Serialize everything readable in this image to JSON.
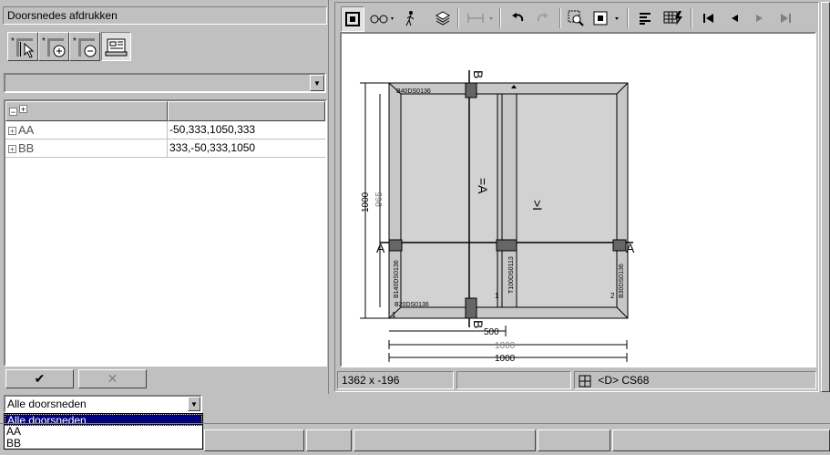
{
  "panel": {
    "title": "Doorsnedes afdrukken",
    "tools": [
      "select-section-tool",
      "add-section-tool",
      "remove-section-tool",
      "print-preview-tool"
    ]
  },
  "table": {
    "header_col2": "",
    "rows": [
      {
        "name": "AA",
        "value": "-50,333,1050,333"
      },
      {
        "name": "BB",
        "value": "333,-50,333,1050"
      }
    ]
  },
  "buttons": {
    "ok": "✔",
    "cancel": "✕"
  },
  "filter": {
    "selected": "Alle doorsneden",
    "options": [
      "Alle doorsneden",
      "AA",
      "BB"
    ]
  },
  "toolbar": {
    "icons": [
      "view-frame-icon",
      "glasses-icon",
      "walk-icon",
      "layers-icon",
      "dimension-icon",
      "undo-icon",
      "redo-icon",
      "zoom-window-icon",
      "zoom-fit-icon",
      "align-icon",
      "lightning-grid-icon",
      "first-icon",
      "prev-icon",
      "next-icon",
      "last-icon"
    ]
  },
  "status": {
    "coords": "1362 x -196",
    "middle": "",
    "layer": "<D> CS68"
  },
  "drawing": {
    "labels": {
      "top_profile": "B40DS0136",
      "bottom_profile": "B20DS0136",
      "left_profile": "B140DS0136",
      "right_profile": "B30DS0136",
      "mullion_profile": "T100DS0113",
      "section_a": "A",
      "section_b": "B",
      "num1": "1",
      "num2": "2",
      "num1b": "1"
    },
    "dims": {
      "height_outer": "1000",
      "height_inner": "965",
      "width_500": "500",
      "width_1000a": "1000",
      "width_1000b": "1000"
    },
    "sash_marks": {
      "left": "=A",
      "right": ">I"
    }
  }
}
